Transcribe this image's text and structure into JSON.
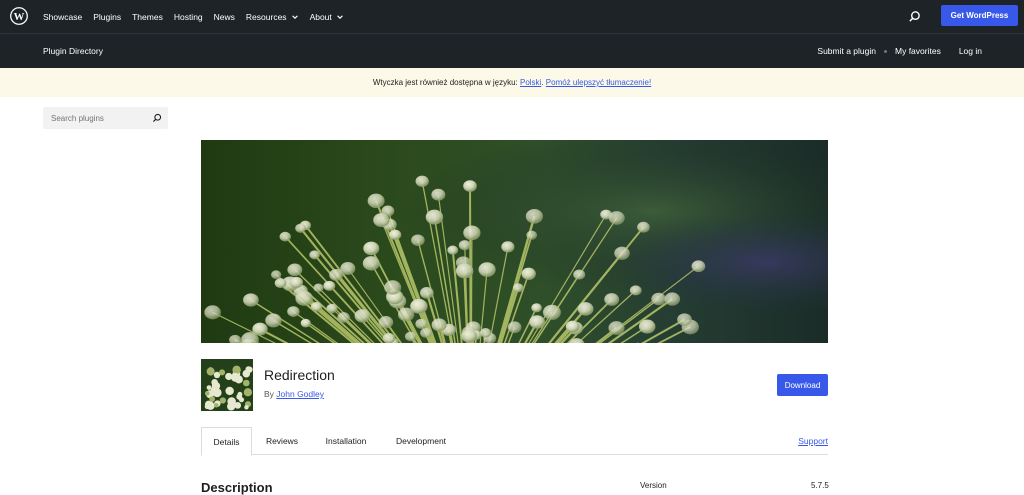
{
  "topbar": {
    "logo_icon": "wordpress-logo-icon",
    "nav": [
      {
        "label": "Showcase",
        "dropdown": false
      },
      {
        "label": "Plugins",
        "dropdown": false
      },
      {
        "label": "Themes",
        "dropdown": false
      },
      {
        "label": "Hosting",
        "dropdown": false
      },
      {
        "label": "News",
        "dropdown": false
      },
      {
        "label": "Resources",
        "dropdown": true
      },
      {
        "label": "About",
        "dropdown": true
      }
    ],
    "search_icon": "search-icon",
    "cta_label": "Get WordPress",
    "cta_color": "#3858e9",
    "background": "#1d2327"
  },
  "subbar": {
    "directory_label": "Plugin Directory",
    "links": [
      "Submit a plugin",
      "My favorites",
      "Log in"
    ]
  },
  "notice": {
    "text": "Wtyczka jest również dostępna w języku: ",
    "language_link": "Polski",
    "separator": ". ",
    "help_link": "Pomóż ulepszyć tłumaczenie!",
    "background": "#fcf9e8"
  },
  "search": {
    "placeholder": "Search plugins",
    "icon": "search-icon"
  },
  "plugin": {
    "title": "Redirection",
    "by_prefix": "By ",
    "author": "John Godley",
    "download_label": "Download"
  },
  "tabs": [
    {
      "label": "Details",
      "active": true
    },
    {
      "label": "Reviews",
      "active": false
    },
    {
      "label": "Installation",
      "active": false
    },
    {
      "label": "Development",
      "active": false
    }
  ],
  "support_label": "Support",
  "content": {
    "heading": "Description",
    "meta": [
      {
        "label": "Version",
        "value": "5.7.5"
      }
    ]
  }
}
